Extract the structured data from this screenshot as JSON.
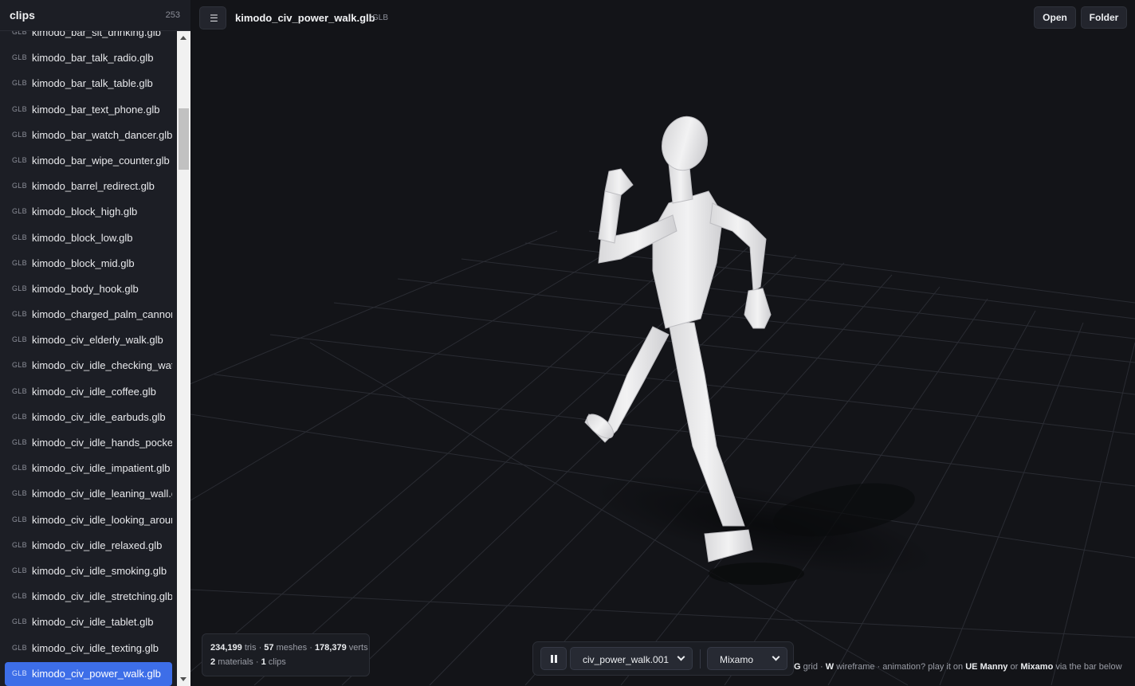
{
  "sidebar": {
    "title": "clips",
    "count": "253",
    "items": [
      {
        "tag": "GLB",
        "name": "kimodo_bar_sit_drinking.glb"
      },
      {
        "tag": "GLB",
        "name": "kimodo_bar_talk_radio.glb"
      },
      {
        "tag": "GLB",
        "name": "kimodo_bar_talk_table.glb"
      },
      {
        "tag": "GLB",
        "name": "kimodo_bar_text_phone.glb"
      },
      {
        "tag": "GLB",
        "name": "kimodo_bar_watch_dancer.glb"
      },
      {
        "tag": "GLB",
        "name": "kimodo_bar_wipe_counter.glb"
      },
      {
        "tag": "GLB",
        "name": "kimodo_barrel_redirect.glb"
      },
      {
        "tag": "GLB",
        "name": "kimodo_block_high.glb"
      },
      {
        "tag": "GLB",
        "name": "kimodo_block_low.glb"
      },
      {
        "tag": "GLB",
        "name": "kimodo_block_mid.glb"
      },
      {
        "tag": "GLB",
        "name": "kimodo_body_hook.glb"
      },
      {
        "tag": "GLB",
        "name": "kimodo_charged_palm_cannon"
      },
      {
        "tag": "GLB",
        "name": "kimodo_civ_elderly_walk.glb"
      },
      {
        "tag": "GLB",
        "name": "kimodo_civ_idle_checking_watc"
      },
      {
        "tag": "GLB",
        "name": "kimodo_civ_idle_coffee.glb"
      },
      {
        "tag": "GLB",
        "name": "kimodo_civ_idle_earbuds.glb"
      },
      {
        "tag": "GLB",
        "name": "kimodo_civ_idle_hands_pocket"
      },
      {
        "tag": "GLB",
        "name": "kimodo_civ_idle_impatient.glb"
      },
      {
        "tag": "GLB",
        "name": "kimodo_civ_idle_leaning_wall.g"
      },
      {
        "tag": "GLB",
        "name": "kimodo_civ_idle_looking_arour"
      },
      {
        "tag": "GLB",
        "name": "kimodo_civ_idle_relaxed.glb"
      },
      {
        "tag": "GLB",
        "name": "kimodo_civ_idle_smoking.glb"
      },
      {
        "tag": "GLB",
        "name": "kimodo_civ_idle_stretching.glb"
      },
      {
        "tag": "GLB",
        "name": "kimodo_civ_idle_tablet.glb"
      },
      {
        "tag": "GLB",
        "name": "kimodo_civ_idle_texting.glb"
      },
      {
        "tag": "GLB",
        "name": "kimodo_civ_power_walk.glb",
        "active": true
      }
    ]
  },
  "header": {
    "menu_icon": "☰",
    "file_title": "kimodo_civ_power_walk.glb",
    "file_format": "GLB",
    "open_label": "Open",
    "folder_label": "Folder"
  },
  "stats": {
    "tris": "234,199",
    "tris_label": "tris",
    "meshes": "57",
    "meshes_label": "meshes",
    "verts": "178,379",
    "verts_label": "verts",
    "materials": "2",
    "materials_label": "materials",
    "clips": "1",
    "clips_label": "clips",
    "separator": "·"
  },
  "playback": {
    "clip_value": "civ_power_walk.001",
    "rig_value": "Mixamo"
  },
  "hint": {
    "key_g": "G",
    "grid": "grid ·",
    "key_w": "W",
    "wireframe": "wireframe · animation? play it on",
    "ue_manny": "UE Manny",
    "or": "or",
    "mixamo": "Mixamo",
    "via": "via the bar below"
  },
  "colors": {
    "accent": "#3d6ee8",
    "background": "#131418",
    "sidebar": "#1c1e25",
    "grid_line": "#2a2c33",
    "figure": "#ebebec"
  }
}
